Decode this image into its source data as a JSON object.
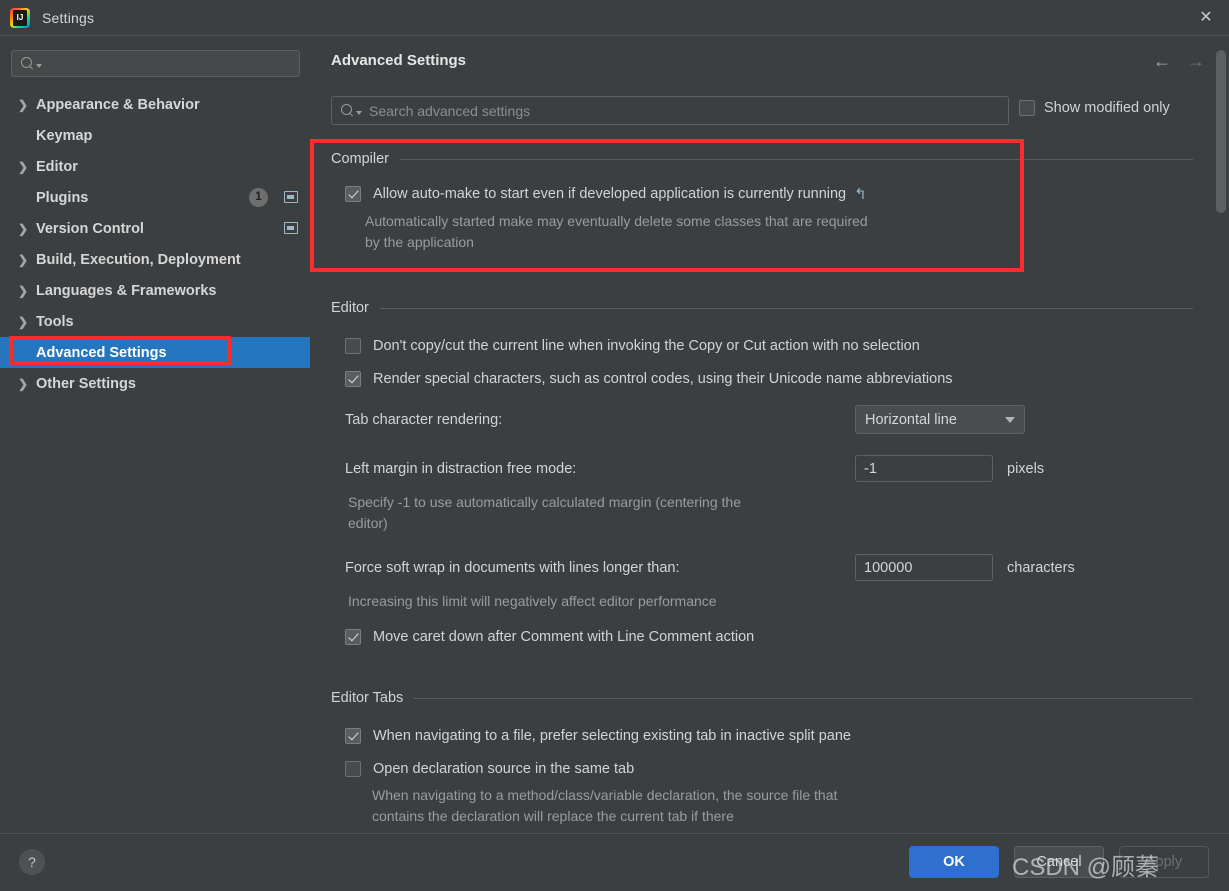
{
  "window": {
    "title": "Settings",
    "app_icon": "intellij-idea-logo",
    "close_icon": "✕"
  },
  "sidebar": {
    "search": {
      "value": "",
      "placeholder": "",
      "icon": "search-icon"
    },
    "items": [
      {
        "label": "Appearance & Behavior",
        "expandable": true,
        "bold": true
      },
      {
        "label": "Keymap",
        "expandable": false,
        "bold": true
      },
      {
        "label": "Editor",
        "expandable": true,
        "bold": true
      },
      {
        "label": "Plugins",
        "expandable": false,
        "bold": true,
        "badge": "1",
        "window_icon": true
      },
      {
        "label": "Version Control",
        "expandable": true,
        "bold": true,
        "window_icon": true
      },
      {
        "label": "Build, Execution, Deployment",
        "expandable": true,
        "bold": true
      },
      {
        "label": "Languages & Frameworks",
        "expandable": true,
        "bold": true
      },
      {
        "label": "Tools",
        "expandable": true,
        "bold": true
      },
      {
        "label": "Advanced Settings",
        "expandable": false,
        "bold": true,
        "selected": true
      },
      {
        "label": "Other Settings",
        "expandable": true,
        "bold": true
      }
    ]
  },
  "panel": {
    "title": "Advanced Settings",
    "back_arrow": "←",
    "forward_arrow": "→",
    "search": {
      "value": "",
      "placeholder": "Search advanced settings",
      "icon": "search-icon"
    },
    "show_modified_only": {
      "label": "Show modified only",
      "checked": false
    }
  },
  "sections": {
    "compiler": {
      "heading": "Compiler",
      "allow_automake": {
        "label": "Allow auto-make to start even if developed application is currently running",
        "checked": true,
        "revert_icon": "↰",
        "description": "Automatically started make may eventually delete some classes that are required by the application"
      }
    },
    "editor": {
      "heading": "Editor",
      "dont_copy_cut": {
        "label": "Don't copy/cut the current line when invoking the Copy or Cut action with no selection",
        "checked": false
      },
      "render_special_chars": {
        "label": "Render special characters, such as control codes, using their Unicode name abbreviations",
        "checked": true
      },
      "tab_char_rendering": {
        "label": "Tab character rendering:",
        "value": "Horizontal line",
        "options": [
          "Horizontal line"
        ]
      },
      "left_margin": {
        "label": "Left margin in distraction free mode:",
        "value": "-1",
        "unit": "pixels",
        "description": "Specify -1 to use automatically calculated margin (centering the editor)"
      },
      "force_soft_wrap": {
        "label": "Force soft wrap in documents with lines longer than:",
        "value": "100000",
        "unit": "characters",
        "description": "Increasing this limit will negatively affect editor performance"
      },
      "move_caret_down": {
        "label": "Move caret down after Comment with Line Comment action",
        "checked": true
      }
    },
    "editor_tabs": {
      "heading": "Editor Tabs",
      "prefer_existing_tab": {
        "label": "When navigating to a file, prefer selecting existing tab in inactive split pane",
        "checked": true
      },
      "open_declaration_same_tab": {
        "label": "Open declaration source in the same tab",
        "checked": false,
        "description": "When navigating to a method/class/variable declaration, the source file that contains the declaration will replace the current tab if there"
      }
    }
  },
  "footer": {
    "help_label": "?",
    "ok_label": "OK",
    "cancel_label": "Cancel",
    "apply_label": "Apply"
  },
  "watermark": {
    "text": "CSDN @顾蓁"
  },
  "colors": {
    "accent_blue": "#2f6fd0",
    "selection_blue": "#2675bf",
    "annotation_red": "#fb2c2c",
    "panel_bg": "#3c3f41"
  }
}
